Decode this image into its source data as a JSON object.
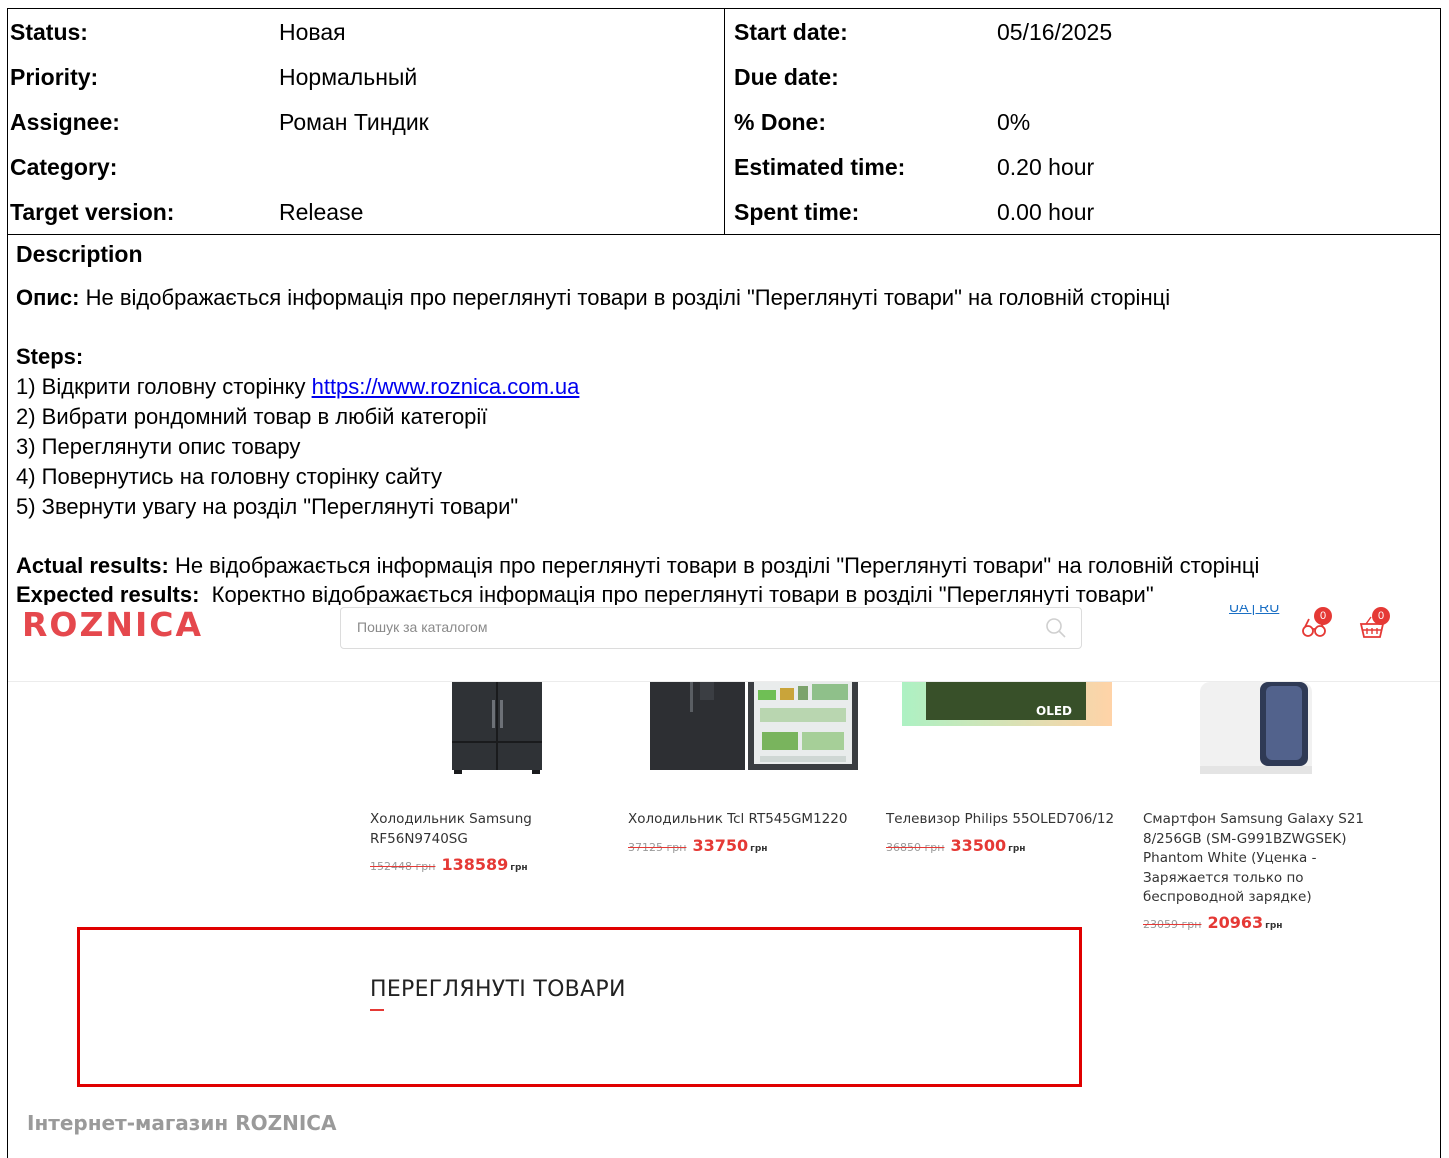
{
  "attributes": {
    "left": [
      {
        "label": "Status:",
        "value": "Новая"
      },
      {
        "label": "Priority:",
        "value": "Нормальный"
      },
      {
        "label": "Assignee:",
        "value": "Роман Тиндик"
      },
      {
        "label": "Category:",
        "value": ""
      },
      {
        "label": "Target version:",
        "value": "Release"
      }
    ],
    "right": [
      {
        "label": "Start date:",
        "value": "05/16/2025"
      },
      {
        "label": "Due date:",
        "value": ""
      },
      {
        "label": "% Done:",
        "value": "0%"
      },
      {
        "label": "Estimated time:",
        "value": "0.20 hour"
      },
      {
        "label": "Spent time:",
        "value": "0.00 hour"
      }
    ]
  },
  "description": {
    "heading": "Description",
    "opys_label": "Опис:",
    "opys_text": " Не відображається інформація про переглянуті товари в розділі \"Переглянуті товари\" на головній сторінці",
    "steps_label": "Steps:",
    "step1_text": "1) Відкрити головну сторінку ",
    "step1_link": "https://www.roznica.com.ua",
    "step2": "2) Вибрати рондомний товар в любій категорії",
    "step3": "3) Переглянути опис товару",
    "step4": "4) Повернутись на головну сторінку сайту",
    "step5": "5) Звернути увагу на розділ \"Переглянуті товари\"",
    "actual_label": "Actual results:",
    "actual_text": " Не відображається інформація про переглянуті товари в розділі \"Переглянуті товари\" на головній сторінці",
    "expected_label": "Expected results:",
    "expected_text": "  Коректно відображається інформація про переглянуті товари в розділі \"Переглянуті товари\""
  },
  "screenshot": {
    "logo": "ROZNICA",
    "search_placeholder": "Пошук за каталогом",
    "lang": "UA | RU",
    "compare_count": "0",
    "cart_count": "0",
    "products": [
      {
        "name": "Холодильник Samsung RF56N9740SG",
        "old_price": "152448 грн",
        "price": "138589",
        "currency": "грн"
      },
      {
        "name": "Холодильник Tcl RT545GM1220",
        "old_price": "37125 грн",
        "price": "33750",
        "currency": "грн"
      },
      {
        "name": "Телевизор Philips 55OLED706/12",
        "old_price": "36850 грн",
        "price": "33500",
        "currency": "грн"
      },
      {
        "name": "Смартфон Samsung Galaxy S21 8/256GB (SM-G991BZWGSEK) Phantom White (Уценка - Заряжается только по беспроводной зарядке)",
        "old_price": "23059 грн",
        "price": "20963",
        "currency": "грн"
      }
    ],
    "tv_badge": "OLED",
    "viewed_title": "ПЕРЕГЛЯНУТІ ТОВАРИ",
    "footer": "Інтернет-магазин ROZNICA"
  }
}
